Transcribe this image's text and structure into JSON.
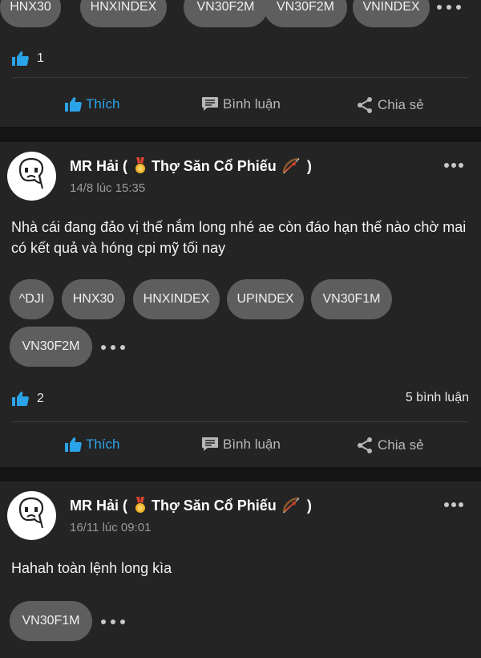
{
  "posts": [
    {
      "tags": [
        "HNX30",
        "HNXINDEX",
        "VN30F2M",
        "VN30F2M",
        "VNINDEX"
      ],
      "likes": "1",
      "actions": {
        "like": "Thích",
        "comment": "Bình luận",
        "share": "Chia sẻ"
      }
    },
    {
      "author": {
        "name": "MR Hải (",
        "title": "Thợ Săn Cổ Phiếu",
        "close": ")"
      },
      "timestamp": "14/8 lúc 15:35",
      "text": "Nhà cái đang đảo vị thế nắm long nhé ae còn đáo hạn thế nào chờ mai có kết quả và hóng cpi mỹ tối nay",
      "tags": [
        "^DJI",
        "HNX30",
        "HNXINDEX",
        "UPINDEX",
        "VN30F1M",
        "VN30F2M"
      ],
      "likes": "2",
      "comments": "5 bình luận",
      "actions": {
        "like": "Thích",
        "comment": "Bình luận",
        "share": "Chia sẻ"
      }
    },
    {
      "author": {
        "name": "MR Hải (",
        "title": "Thợ Săn Cổ Phiếu",
        "close": ")"
      },
      "timestamp": "16/11 lúc 09:01",
      "text": "Hahah toàn lệnh long kìa",
      "tags": [
        "VN30F1M"
      ]
    }
  ],
  "colors": {
    "accent": "#2aa3e8",
    "card": "#242424",
    "tag": "#5e5e5e",
    "background": "#141414"
  },
  "icons": [
    "thumbs-up-icon",
    "comment-icon",
    "share-icon",
    "more-icon",
    "medal-icon",
    "bow-icon",
    "avatar"
  ]
}
